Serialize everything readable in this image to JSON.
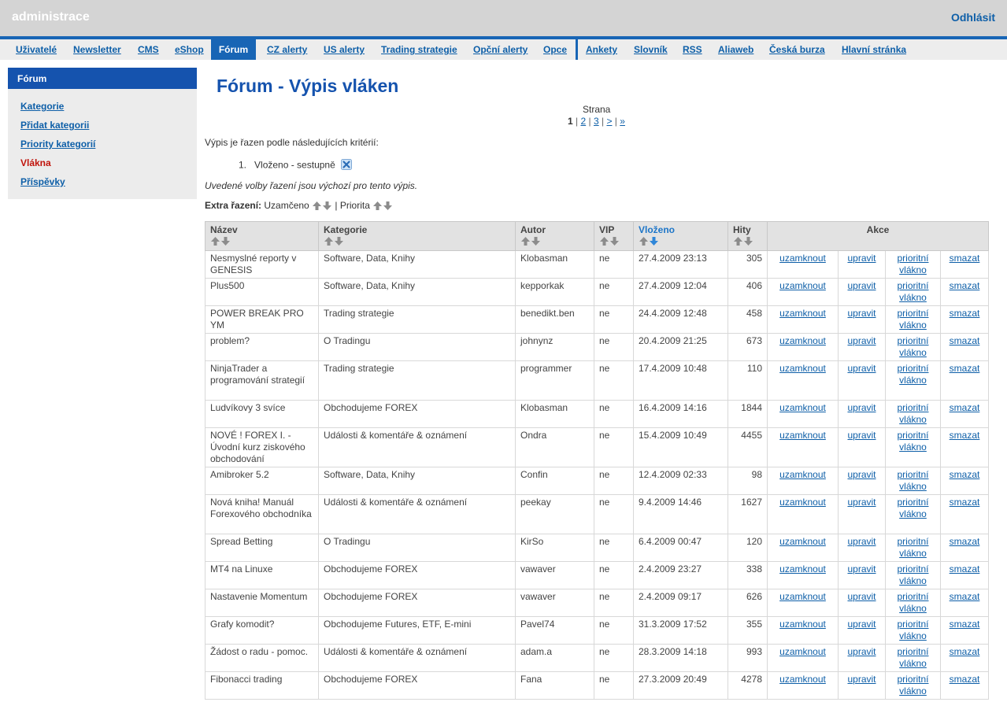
{
  "header": {
    "brand": "administrace",
    "logout": "Odhlásit"
  },
  "nav": [
    {
      "label": "Uživatelé",
      "active": false
    },
    {
      "label": "Newsletter",
      "active": false
    },
    {
      "label": "CMS",
      "active": false
    },
    {
      "label": "eShop",
      "active": false
    },
    {
      "label": "Fórum",
      "active": true
    },
    {
      "label": "CZ alerty",
      "active": false
    },
    {
      "label": "US alerty",
      "active": false
    },
    {
      "label": "Trading strategie",
      "active": false
    },
    {
      "label": "Opční alerty",
      "active": false
    },
    {
      "label": "Opce",
      "active": false
    },
    {
      "label": "Ankety",
      "active": false
    },
    {
      "label": "Slovník",
      "active": false
    },
    {
      "label": "RSS",
      "active": false
    },
    {
      "label": "Aliaweb",
      "active": false
    },
    {
      "label": "Česká burza",
      "active": false
    },
    {
      "label": "Hlavní stránka",
      "active": false
    }
  ],
  "sidebar": {
    "title": "Fórum",
    "items": [
      {
        "label": "Kategorie",
        "active": false
      },
      {
        "label": "Přidat kategorii",
        "active": false
      },
      {
        "label": "Priority kategorií",
        "active": false
      },
      {
        "label": "Vlákna",
        "active": true
      },
      {
        "label": "Příspěvky",
        "active": false
      }
    ]
  },
  "main": {
    "title": "Fórum - Výpis vláken",
    "pager": {
      "label": "Strana",
      "current": "1",
      "pages": [
        "2",
        "3"
      ],
      "next": ">",
      "last": "»",
      "separator": "|"
    },
    "criteria_intro": "Výpis je řazen podle následujících kritérií:",
    "criteria": [
      {
        "number": "1.",
        "text": "Vloženo - sestupně"
      }
    ],
    "criteria_note": "Uvedené volby řazení jsou výchozí pro tento výpis.",
    "extra": {
      "label": "Extra řazení:",
      "first": "Uzamčeno",
      "separator": "|",
      "second": "Priorita"
    }
  },
  "table": {
    "headers": [
      "Název",
      "Kategorie",
      "Autor",
      "VIP",
      "Vloženo",
      "Hity",
      "Akce"
    ],
    "actions": [
      "uzamknout",
      "upravit",
      "prioritní vlákno",
      "smazat"
    ],
    "rows": [
      [
        "Nesmyslné reporty v GENESIS",
        "Software, Data, Knihy",
        "Klobasman",
        "ne",
        "27.4.2009 23:13",
        "305"
      ],
      [
        "Plus500",
        "Software, Data, Knihy",
        "kepporkak",
        "ne",
        "27.4.2009 12:04",
        "406"
      ],
      [
        "POWER BREAK PRO YM",
        "Trading strategie",
        "benedikt.ben",
        "ne",
        "24.4.2009 12:48",
        "458"
      ],
      [
        "problem?",
        "O Tradingu",
        "johnynz",
        "ne",
        "20.4.2009 21:25",
        "673"
      ],
      [
        "NinjaTrader a programování strategií",
        "Trading strategie",
        "programmer",
        "ne",
        "17.4.2009 10:48",
        "110"
      ],
      [
        "Ludvíkovy 3 svíce",
        "Obchodujeme FOREX",
        "Klobasman",
        "ne",
        "16.4.2009 14:16",
        "1844"
      ],
      [
        "NOVÉ ! FOREX I. - Úvodní kurz ziskového obchodování",
        "Události & komentáře & oznámení",
        "Ondra",
        "ne",
        "15.4.2009 10:49",
        "4455"
      ],
      [
        "Amibroker 5.2",
        "Software, Data, Knihy",
        "Confin",
        "ne",
        "12.4.2009 02:33",
        "98"
      ],
      [
        "Nová kniha! Manuál Forexového obchodníka",
        "Události & komentáře & oznámení",
        "peekay",
        "ne",
        "9.4.2009 14:46",
        "1627"
      ],
      [
        "Spread Betting",
        "O Tradingu",
        "KirSo",
        "ne",
        "6.4.2009 00:47",
        "120"
      ],
      [
        "MT4 na Linuxe",
        "Obchodujeme FOREX",
        "vawaver",
        "ne",
        "2.4.2009 23:27",
        "338"
      ],
      [
        "Nastavenie Momentum",
        "Obchodujeme FOREX",
        "vawaver",
        "ne",
        "2.4.2009 09:17",
        "626"
      ],
      [
        "Grafy komodit?",
        "Obchodujeme Futures, ETF, E-mini",
        "Pavel74",
        "ne",
        "31.3.2009 17:52",
        "355"
      ],
      [
        "Žádost o radu - pomoc.",
        "Události & komentáře & oznámení",
        "adam.a",
        "ne",
        "28.3.2009 14:18",
        "993"
      ],
      [
        "Fibonacci trading",
        "Obchodujeme FOREX",
        "Fana",
        "ne",
        "27.3.2009 20:49",
        "4278"
      ]
    ]
  }
}
